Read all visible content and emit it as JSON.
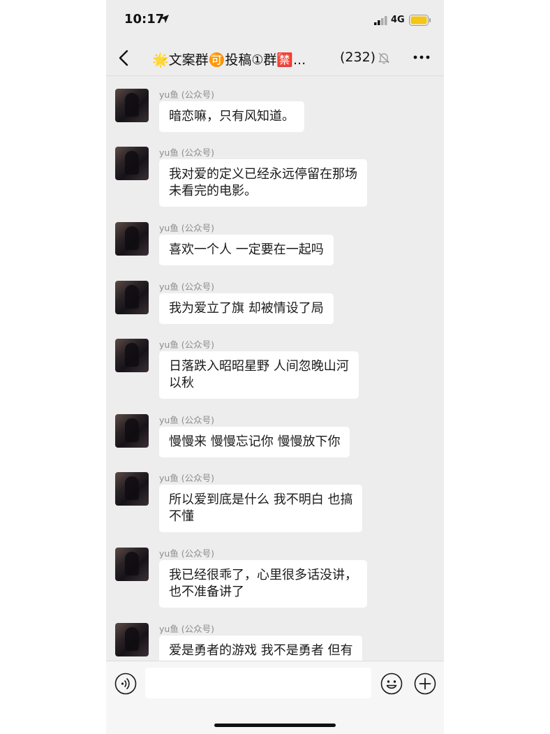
{
  "status_bar": {
    "time": "10:17",
    "network": "4G",
    "battery_color": "#f5c518"
  },
  "nav": {
    "title": "🌟文案群🉑投稿①群🈲...",
    "member_count": "(232)"
  },
  "messages": [
    {
      "sender": "yu鱼 (公众号)",
      "lines": [
        "暗恋嘛，只有风知道。"
      ]
    },
    {
      "sender": "yu鱼 (公众号)",
      "lines": [
        "我对爱的定义已经永远停留在那场",
        "未看完的电影。"
      ]
    },
    {
      "sender": "yu鱼 (公众号)",
      "lines": [
        "喜欢一个人  一定要在一起吗"
      ]
    },
    {
      "sender": "yu鱼 (公众号)",
      "lines": [
        "我为爱立了旗  却被情设了局"
      ]
    },
    {
      "sender": "yu鱼 (公众号)",
      "lines": [
        "日落跌入昭昭星野 人间忽晚山河",
        "以秋"
      ]
    },
    {
      "sender": "yu鱼 (公众号)",
      "lines": [
        "慢慢来  慢慢忘记你  慢慢放下你"
      ]
    },
    {
      "sender": "yu鱼 (公众号)",
      "lines": [
        "所以爱到底是什么  我不明白  也搞",
        "不懂"
      ]
    },
    {
      "sender": "yu鱼 (公众号)",
      "lines": [
        "我已经很乖了，心里很多话没讲，",
        "也不准备讲了"
      ]
    },
    {
      "sender": "yu鱼 (公众号)",
      "lines": [
        "爱是勇者的游戏 我不是勇者 但有"
      ]
    }
  ],
  "input": {
    "value": "",
    "placeholder": ""
  }
}
